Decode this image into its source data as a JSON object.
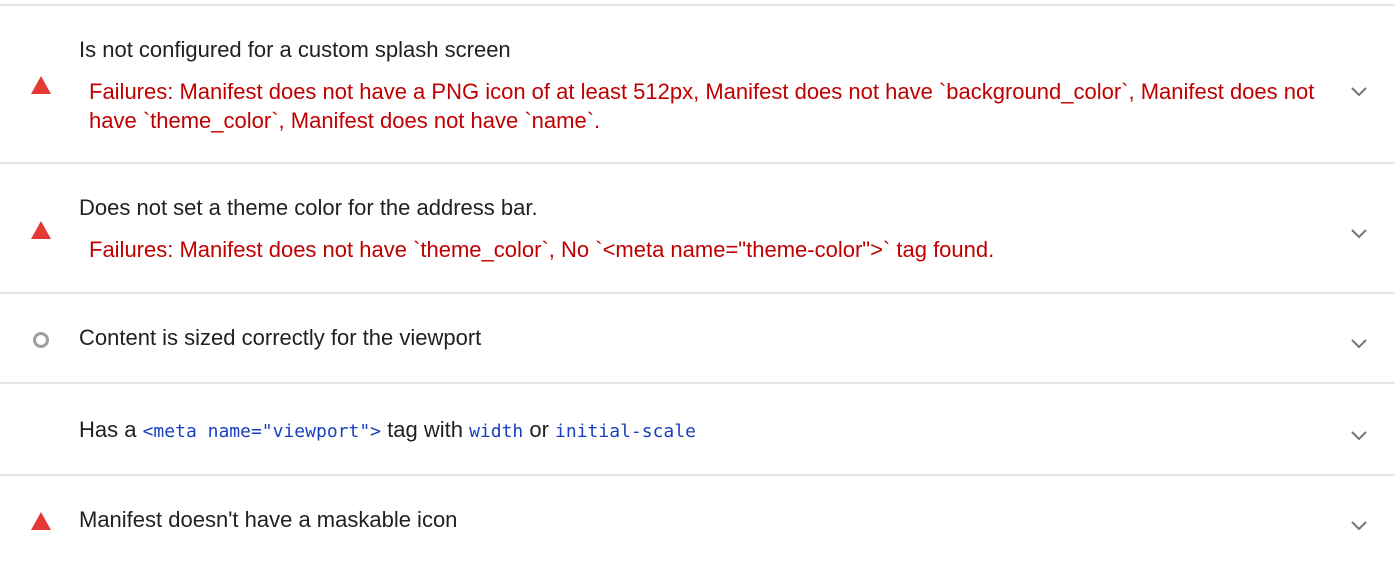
{
  "audits": [
    {
      "status": "fail",
      "status_icon": "red-triangle-icon",
      "title": "Is not configured for a custom splash screen",
      "failures": "Failures: Manifest does not have a PNG icon of at least 512px, Manifest does not have `background_color`, Manifest does not have `theme_color`, Manifest does not have `name`."
    },
    {
      "status": "fail",
      "status_icon": "red-triangle-icon",
      "title": "Does not set a theme color for the address bar.",
      "failures": "Failures: Manifest does not have `theme_color`, No `<meta name=\"theme-color\">` tag found."
    },
    {
      "status": "manual",
      "status_icon": "gray-circle-icon",
      "title": "Content is sized correctly for the viewport"
    },
    {
      "status": "none",
      "title_prefix": "Has a ",
      "title_code_1": "<meta name=\"viewport\">",
      "title_middle": " tag with ",
      "title_code_2": "width",
      "title_or": " or ",
      "title_code_3": "initial-scale"
    },
    {
      "status": "fail",
      "status_icon": "red-triangle-icon",
      "title": "Manifest doesn't have a maskable icon"
    }
  ],
  "colors": {
    "fail": "#e53935",
    "failure_text": "#c00000",
    "manual": "#9e9e9e",
    "code": "#1a3fbf",
    "divider": "#e6e6e6"
  },
  "icons": {
    "expand": "chevron-down-icon"
  }
}
